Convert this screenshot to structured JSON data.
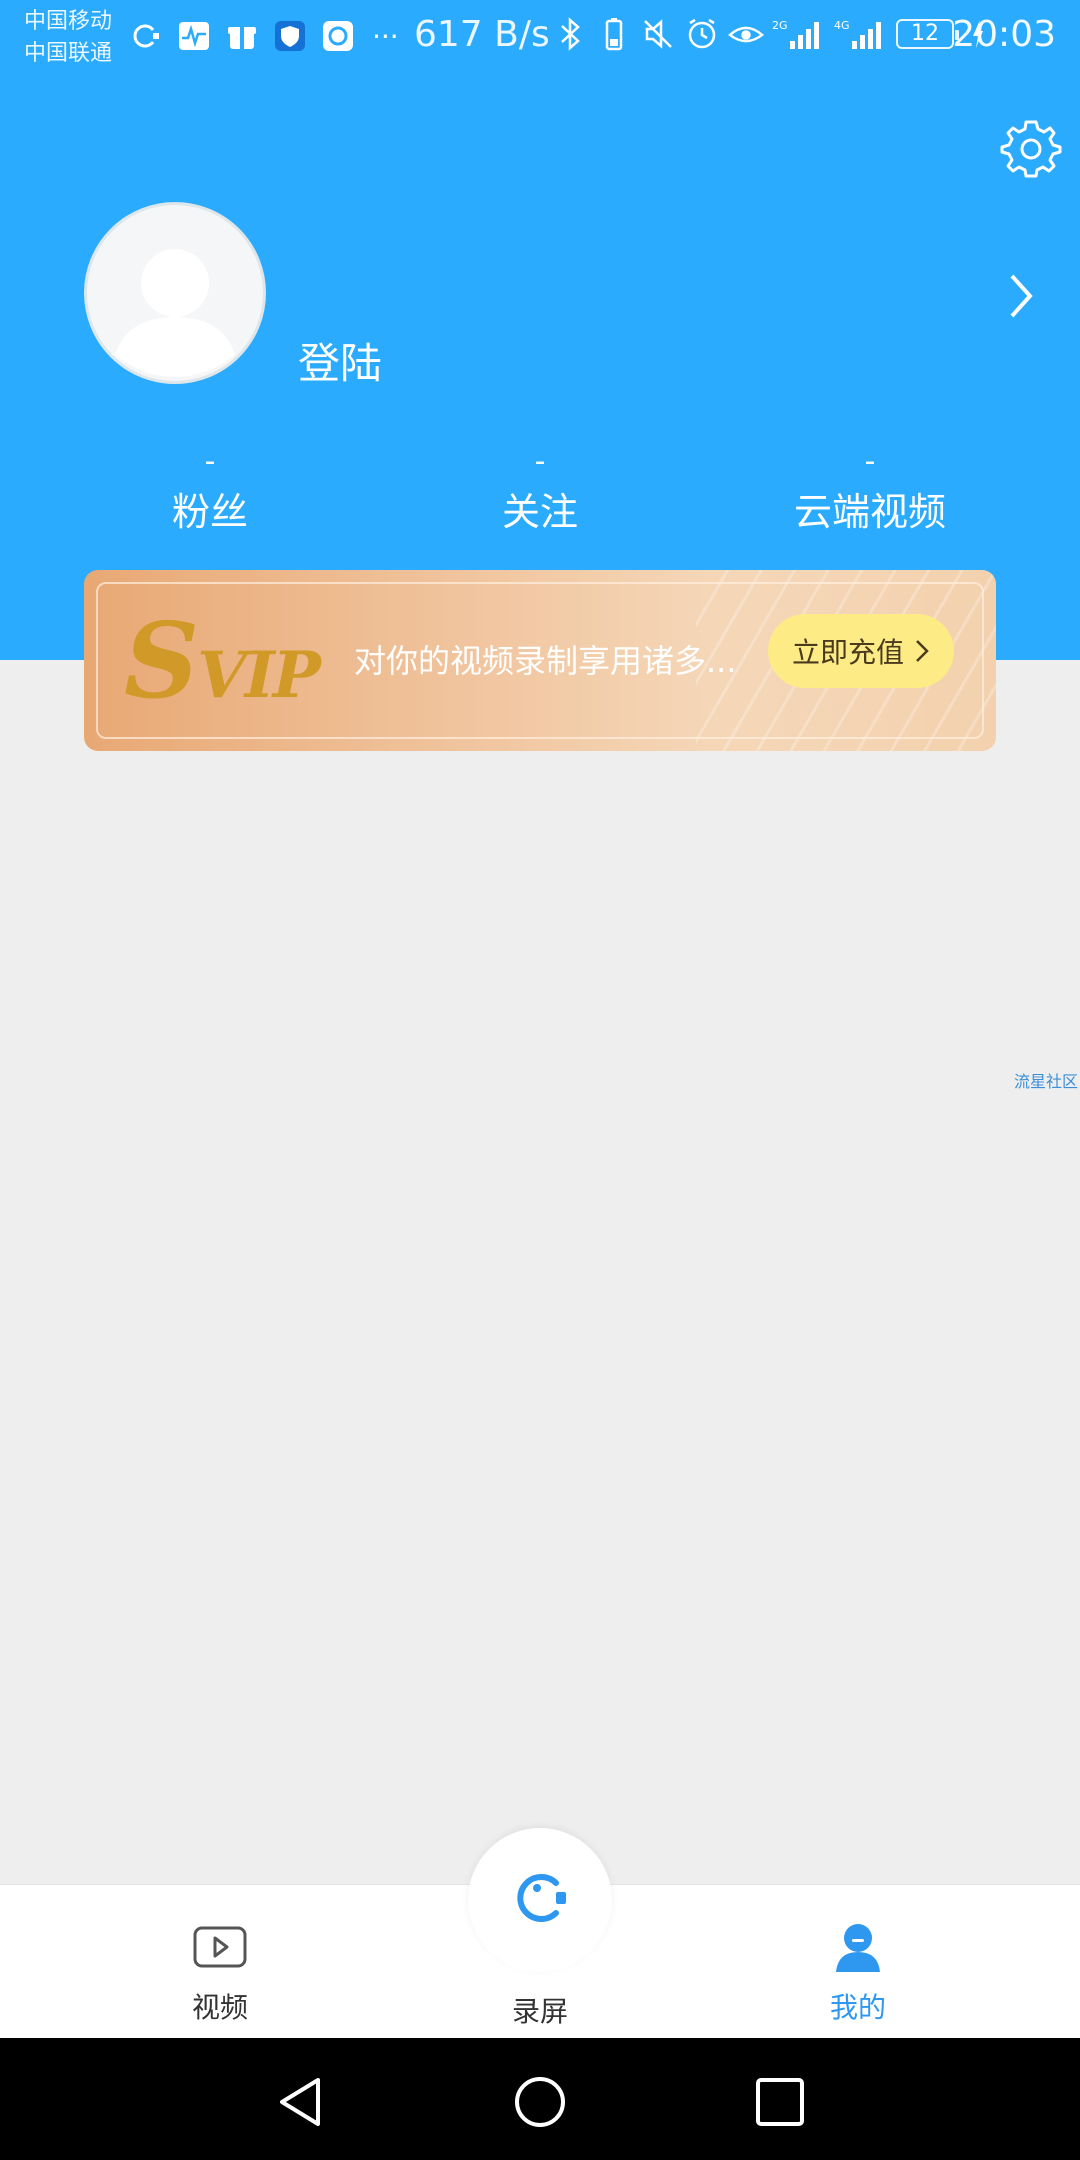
{
  "status_bar": {
    "carrier_1": "中国移动",
    "carrier_2": "中国联通",
    "net_speed": "617 B/s",
    "network_1": "2G",
    "network_2": "4G",
    "battery": "12",
    "time": "20:03",
    "more": "···"
  },
  "profile": {
    "login_label": "登陆"
  },
  "stats": [
    {
      "value": "-",
      "label": "粉丝"
    },
    {
      "value": "-",
      "label": "关注"
    },
    {
      "value": "-",
      "label": "云端视频"
    }
  ],
  "vip_banner": {
    "logo_s": "S",
    "logo_rest": "VIP",
    "text": "对你的视频录制享用诸多...",
    "button_label": "立即充值"
  },
  "side_link": "流星社区",
  "bottom_nav": {
    "video_label": "视频",
    "record_label": "录屏",
    "mine_label": "我的"
  },
  "colors": {
    "header_blue": "#2AABFE",
    "active_blue": "#2E97F0",
    "vip_button": "#FDEB86",
    "vip_gold": "#D19A28"
  }
}
